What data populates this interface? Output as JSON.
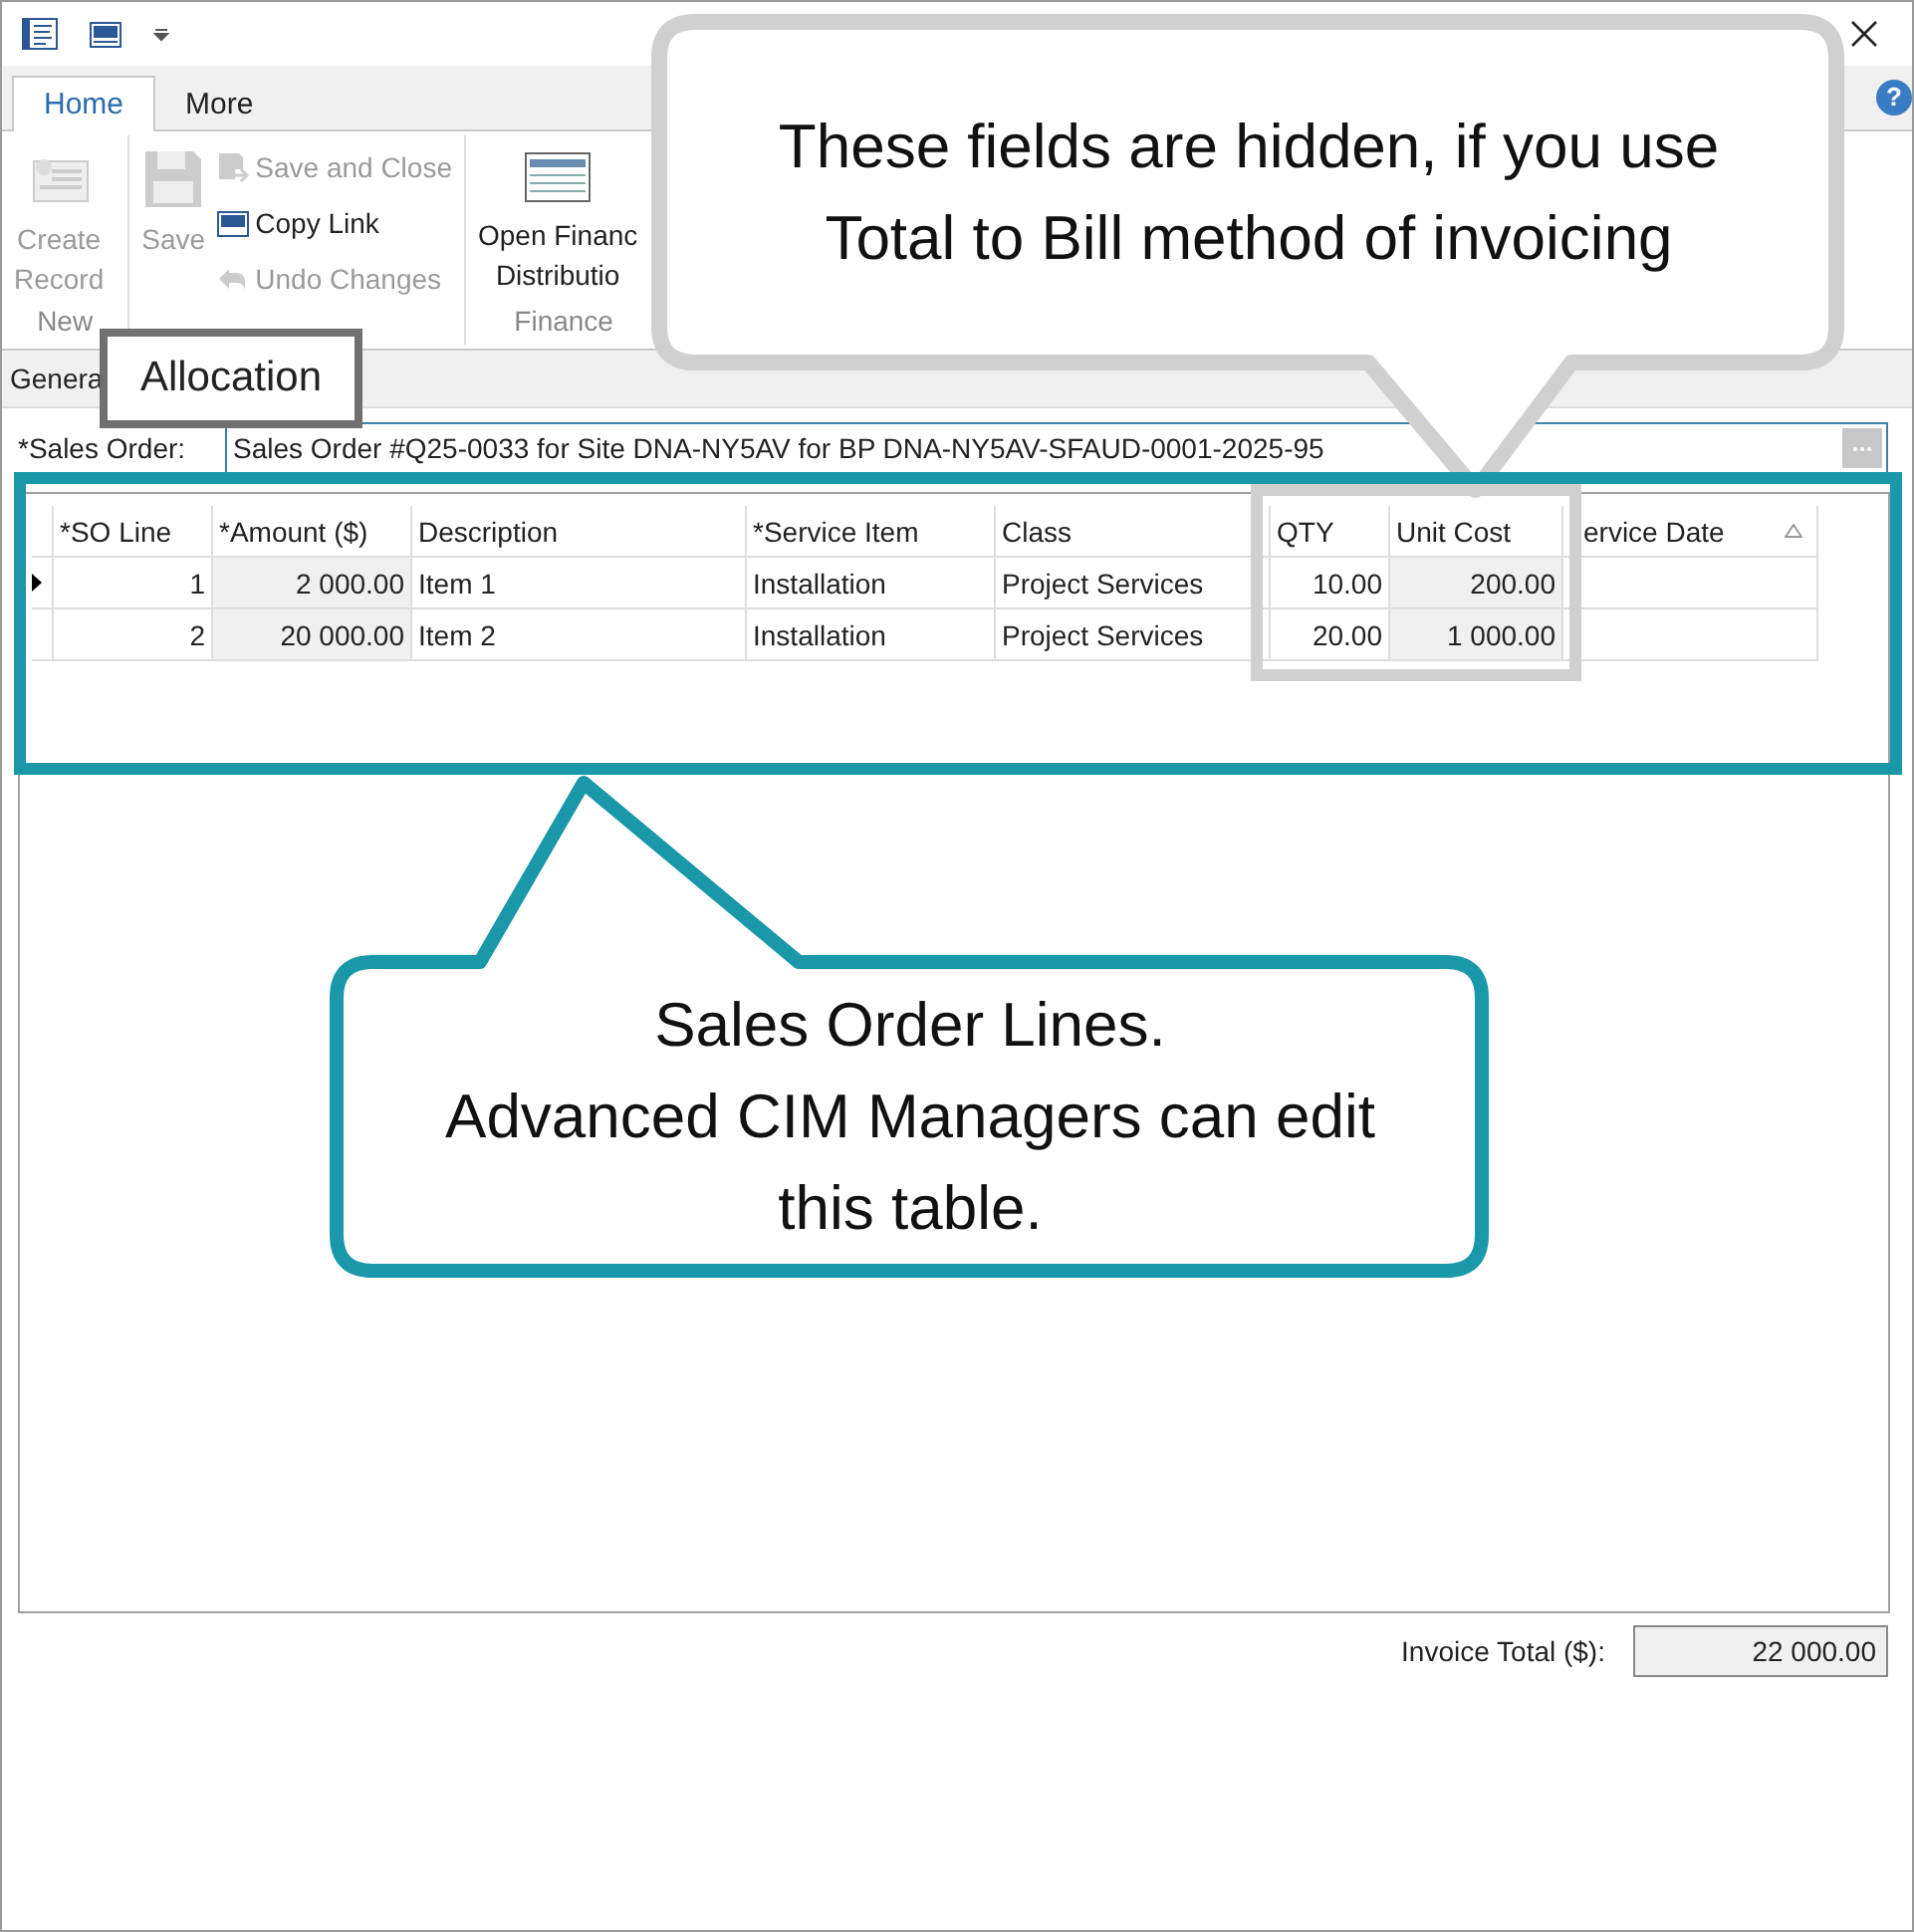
{
  "tabs": [
    {
      "label": "Home",
      "selected": true
    },
    {
      "label": "More",
      "selected": false
    }
  ],
  "help_button": "?",
  "ribbon": [
    {
      "label": "New",
      "buttons": [
        {
          "label": "Create\nRecord",
          "kind": "large",
          "disabled": true
        }
      ]
    },
    {
      "buttons": [
        {
          "label": "Save",
          "kind": "large",
          "disabled": true
        },
        {
          "label": "Save and Close",
          "kind": "small",
          "disabled": true
        },
        {
          "label": "Copy Link",
          "kind": "small",
          "disabled": false
        },
        {
          "label": "Undo Changes",
          "kind": "small",
          "disabled": true
        }
      ]
    },
    {
      "label": "Finance",
      "buttons": [
        {
          "label": "Open Financ\nDistributio",
          "kind": "large",
          "disabled": false
        }
      ]
    }
  ],
  "form_tabs": [
    {
      "label": "Genera"
    }
  ],
  "sales_order": {
    "label": "*Sales Order:",
    "value": "Sales Order #Q25-0033 for Site DNA-NY5AV for BP DNA-NY5AV-SFAUD-0001-2025-95"
  },
  "grid": {
    "columns": [
      {
        "label": "*SO Line",
        "readonly": false
      },
      {
        "label": "*Amount ($)",
        "readonly": true
      },
      {
        "label": "Description",
        "readonly": false
      },
      {
        "label": "*Service Item",
        "readonly": false
      },
      {
        "label": "Class",
        "readonly": false
      },
      {
        "label": "QTY",
        "readonly": false
      },
      {
        "label": "Unit Cost",
        "readonly": true
      },
      {
        "label": "ervice Date",
        "readonly": false
      }
    ],
    "rows": [
      {
        "current": true,
        "cells": [
          "1",
          "2 000.00",
          "Item 1",
          "Installation",
          "Project Services",
          "10.00",
          "200.00",
          ""
        ]
      },
      {
        "current": false,
        "cells": [
          "2",
          "20 000.00",
          "Item 2",
          "Installation",
          "Project Services",
          "20.00",
          "1 000.00",
          ""
        ]
      }
    ]
  },
  "invoice_total": {
    "label": "Invoice Total ($):",
    "value": "22 000.00"
  },
  "callouts": [
    {
      "kind": "bubble",
      "color": "#d0d0d0",
      "text": "These fields are hidden, if you use\nTotal to Bill method of invoicing"
    },
    {
      "kind": "tag",
      "color": "#707070",
      "text": "Allocation"
    },
    {
      "kind": "frame",
      "color": "#d0d0d0"
    },
    {
      "kind": "frame",
      "color": "#1a97a8"
    },
    {
      "kind": "bubble",
      "color": "#1a97a8",
      "text": "Sales Order Lines.\nAdvanced CIM Managers can edit\nthis table."
    }
  ]
}
